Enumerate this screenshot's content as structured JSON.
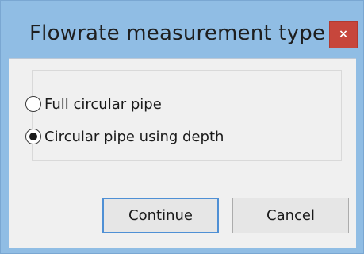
{
  "window": {
    "title": "Flowrate measurement type",
    "close_label": "×"
  },
  "options": [
    {
      "label": "Full circular pipe",
      "selected": false
    },
    {
      "label": "Circular pipe using depth",
      "selected": true
    }
  ],
  "buttons": {
    "continue_label": "Continue",
    "cancel_label": "Cancel"
  },
  "colors": {
    "frame": "#90bde4",
    "close_button": "#c7463c",
    "client_background": "#f0f0f0",
    "default_button_border": "#4f90d5"
  },
  "icons": {
    "close": "close-icon"
  }
}
